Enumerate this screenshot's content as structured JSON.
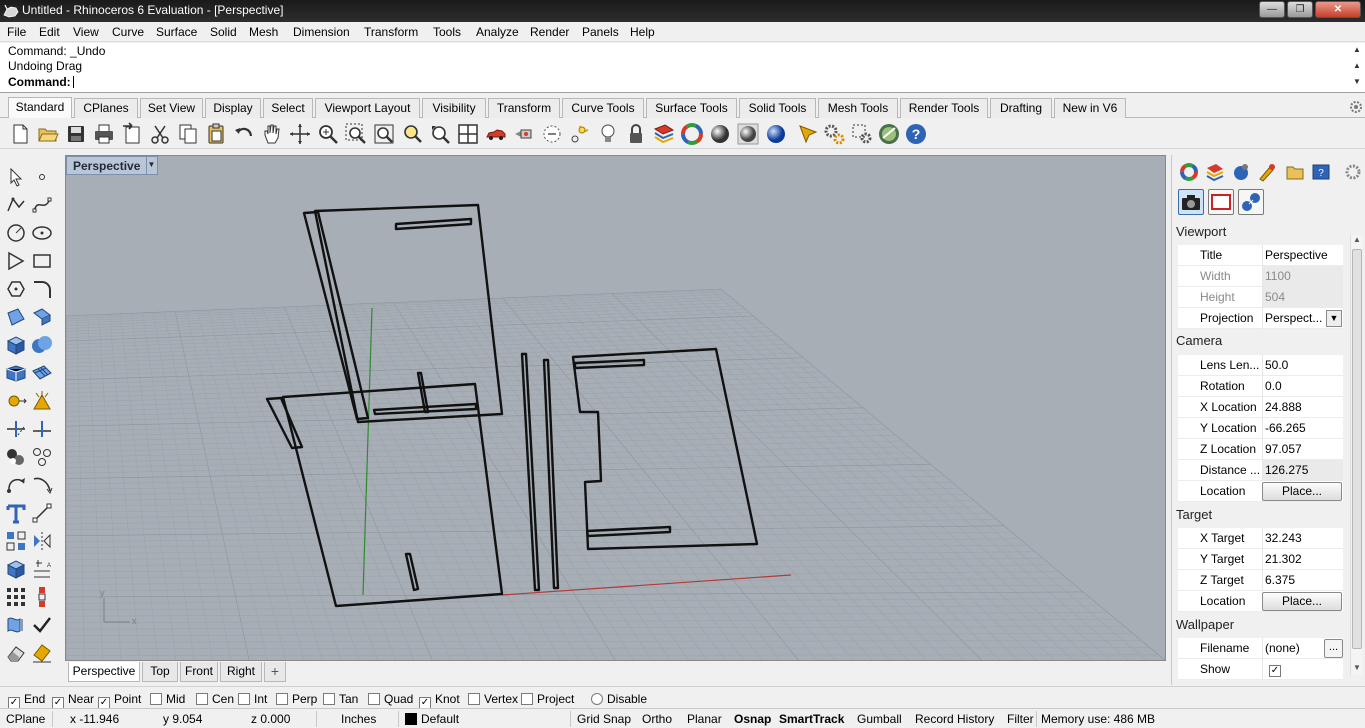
{
  "window": {
    "title": "Untitled - Rhinoceros 6 Evaluation - [Perspective]",
    "minimize": "—",
    "maximize": "❐",
    "close": "✕"
  },
  "menu": [
    "File",
    "Edit",
    "View",
    "Curve",
    "Surface",
    "Solid",
    "Mesh",
    "Dimension",
    "Transform",
    "Tools",
    "Analyze",
    "Render",
    "Panels",
    "Help"
  ],
  "command": {
    "history": [
      "Command: _Undo",
      "Undoing Drag"
    ],
    "prompt": "Command:"
  },
  "toolbar_tabs": [
    "Standard",
    "CPlanes",
    "Set View",
    "Display",
    "Select",
    "Viewport Layout",
    "Visibility",
    "Transform",
    "Curve Tools",
    "Surface Tools",
    "Solid Tools",
    "Mesh Tools",
    "Render Tools",
    "Drafting",
    "New in V6"
  ],
  "toolbar_icons": [
    "new-file-icon",
    "open-file-icon",
    "save-icon",
    "print-icon",
    "import-icon",
    "cut-icon",
    "copy-icon",
    "paste-icon",
    "undo-icon",
    "pan-icon",
    "rotate-view-icon",
    "zoom-icon",
    "zoom-window-icon",
    "zoom-extents-icon",
    "zoom-selected-icon",
    "four-viewports-icon",
    "car-icon",
    "camera-icon",
    "select-icon",
    "light-icon",
    "bulb-icon",
    "lock-icon",
    "layers-icon",
    "color-wheel-icon",
    "sphere-shaded-icon",
    "sphere-render-icon",
    "sphere-material-icon",
    "render-icon",
    "settings-icon",
    "gear-icon",
    "globe-icon",
    "help-icon"
  ],
  "viewport": {
    "title": "Perspective",
    "axis_x": "x",
    "axis_y": "y"
  },
  "viewport_tabs": [
    "Perspective",
    "Top",
    "Front",
    "Right"
  ],
  "panel": {
    "sections": {
      "viewport": "Viewport",
      "camera": "Camera",
      "target": "Target",
      "wallpaper": "Wallpaper"
    },
    "viewport_rows": [
      {
        "k": "Title",
        "v": "Perspective"
      },
      {
        "k": "Width",
        "v": "1100"
      },
      {
        "k": "Height",
        "v": "504"
      },
      {
        "k": "Projection",
        "v": "Perspect..."
      }
    ],
    "camera_rows": [
      {
        "k": "Lens Len...",
        "v": "50.0"
      },
      {
        "k": "Rotation",
        "v": "0.0"
      },
      {
        "k": "X Location",
        "v": "24.888"
      },
      {
        "k": "Y Location",
        "v": "-66.265"
      },
      {
        "k": "Z Location",
        "v": "97.057"
      },
      {
        "k": "Distance ...",
        "v": "126.275"
      },
      {
        "k": "Location",
        "v": "Place..."
      }
    ],
    "target_rows": [
      {
        "k": "X Target",
        "v": "32.243"
      },
      {
        "k": "Y Target",
        "v": "21.302"
      },
      {
        "k": "Z Target",
        "v": "6.375"
      },
      {
        "k": "Location",
        "v": "Place..."
      }
    ],
    "wallpaper_rows": [
      {
        "k": "Filename",
        "v": "(none)"
      },
      {
        "k": "Show",
        "v": "✓"
      }
    ],
    "browse": "..."
  },
  "osnaps": [
    {
      "label": "End",
      "checked": true
    },
    {
      "label": "Near",
      "checked": true
    },
    {
      "label": "Point",
      "checked": true
    },
    {
      "label": "Mid",
      "checked": false
    },
    {
      "label": "Cen",
      "checked": false
    },
    {
      "label": "Int",
      "checked": false
    },
    {
      "label": "Perp",
      "checked": false
    },
    {
      "label": "Tan",
      "checked": false
    },
    {
      "label": "Quad",
      "checked": false
    },
    {
      "label": "Knot",
      "checked": true
    },
    {
      "label": "Vertex",
      "checked": false
    },
    {
      "label": "Project",
      "checked": false
    },
    {
      "label": "Disable",
      "checked": false
    }
  ],
  "status": {
    "cplane": "CPlane",
    "x": "x -11.946",
    "y": "y 9.054",
    "z": "z 0.000",
    "units": "Inches",
    "layer": "Default",
    "gridsnap": "Grid Snap",
    "ortho": "Ortho",
    "planar": "Planar",
    "osnap": "Osnap",
    "smarttrack": "SmartTrack",
    "gumball": "Gumball",
    "history": "Record History",
    "filter": "Filter",
    "memory": "Memory use: 486 MB"
  }
}
